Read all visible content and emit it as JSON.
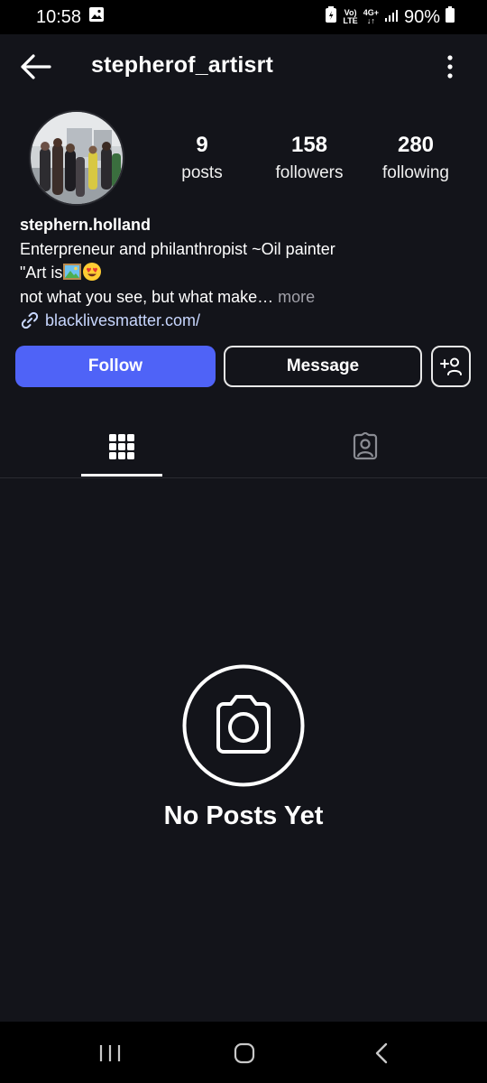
{
  "status_bar": {
    "time": "10:58",
    "net_top": "Vo)",
    "net_bottom": "LTE",
    "gen_top": "4G+",
    "gen_bottom": "↓↑",
    "battery": "90%"
  },
  "header": {
    "username": "stepherof_artisrt"
  },
  "stats": {
    "posts": {
      "count": "9",
      "label": "posts"
    },
    "followers": {
      "count": "158",
      "label": "followers"
    },
    "following": {
      "count": "280",
      "label": "following"
    }
  },
  "bio": {
    "name": "stephern.holland",
    "line1": "Enterpreneur and philanthropist ~Oil painter",
    "line2_prefix": "\"Art is",
    "line3": "not what you see, but what make…",
    "more": "more",
    "link": "blacklivesmatter.com/"
  },
  "actions": {
    "follow": "Follow",
    "message": "Message"
  },
  "empty_state": {
    "text": "No Posts Yet"
  },
  "colors": {
    "background": "#13141a",
    "accent": "#4f63f7",
    "link": "#c8d7ff"
  }
}
